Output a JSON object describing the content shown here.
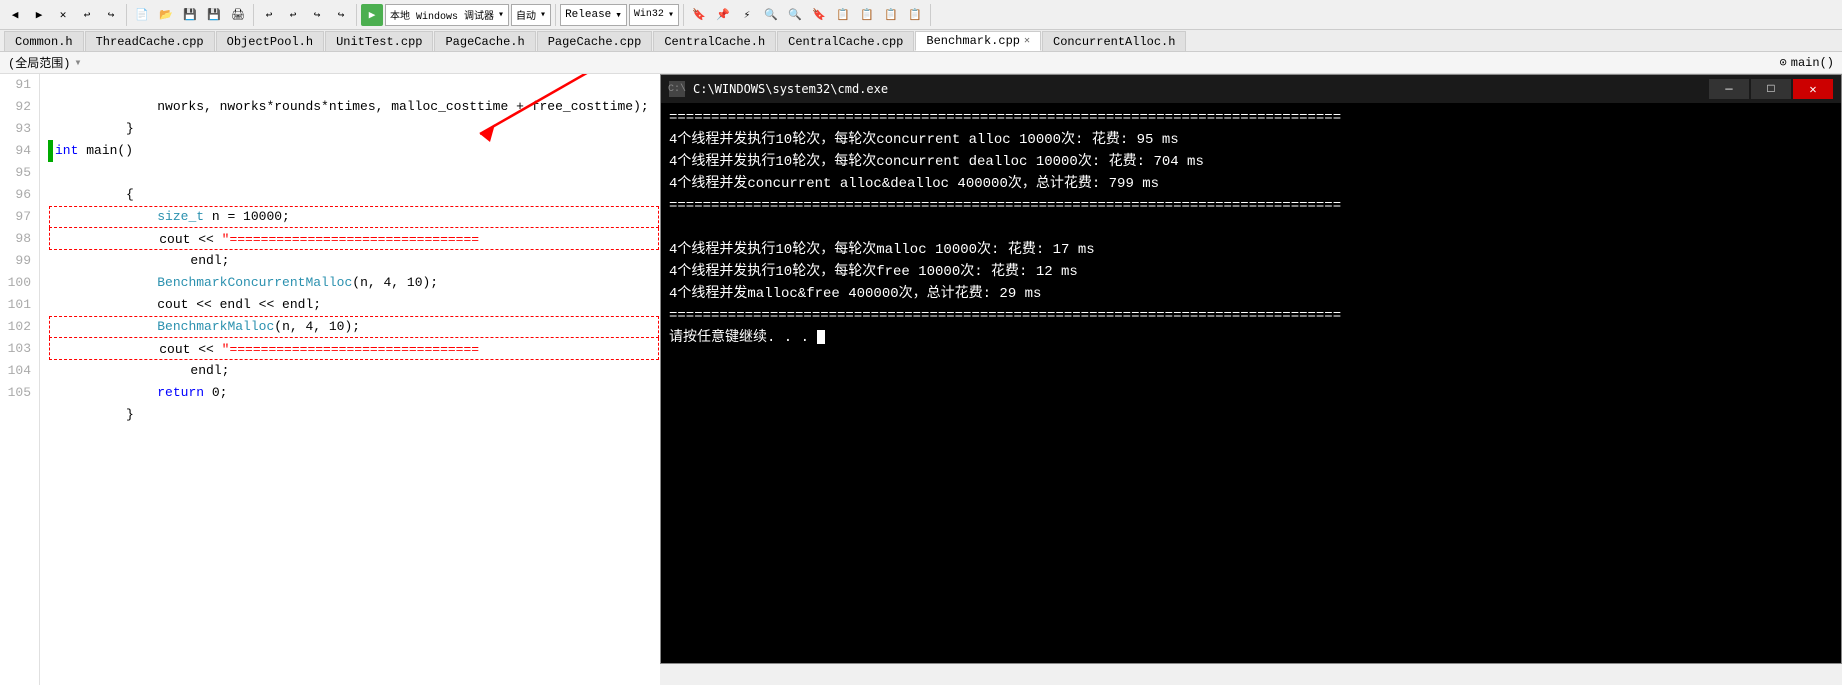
{
  "toolbar": {
    "groups": [
      {
        "buttons": [
          "◀",
          "▶",
          "✕",
          "↩",
          "↪"
        ]
      },
      {
        "buttons": [
          "💾",
          "📋",
          "📂",
          "💾",
          "🖨"
        ]
      },
      {
        "buttons": [
          "↩",
          "↪",
          "↩",
          "↪"
        ]
      },
      {
        "buttons": [
          "▶"
        ]
      },
      {
        "dropdown_local": "本地 Windows 调试器",
        "dropdown_auto": "自动"
      },
      {
        "dropdown_release": "Release",
        "dropdown_win32": "Win32"
      },
      {
        "buttons": [
          "🔖",
          "📌",
          "⚡",
          "🔍",
          "🔍",
          "🔍",
          "🔖",
          "📋",
          "📋",
          "📋",
          "📋"
        ]
      }
    ],
    "play_btn": "▶",
    "local_debugger": "本地 Windows 调试器",
    "auto_label": "自动",
    "release_label": "Release",
    "win32_label": "Win32"
  },
  "tabs": [
    {
      "label": "Common.h",
      "active": false
    },
    {
      "label": "ThreadCache.cpp",
      "active": false
    },
    {
      "label": "ObjectPool.h",
      "active": false
    },
    {
      "label": "UnitTest.cpp",
      "active": false
    },
    {
      "label": "PageCache.h",
      "active": false
    },
    {
      "label": "PageCache.cpp",
      "active": false
    },
    {
      "label": "CentralCache.h",
      "active": false
    },
    {
      "label": "CentralCache.cpp",
      "active": false
    },
    {
      "label": "Benchmark.cpp",
      "active": true,
      "closeable": true
    },
    {
      "label": "ConcurrentAlloc.h",
      "active": false
    }
  ],
  "breadcrumb": {
    "scope": "(全局范围)",
    "function": "main()"
  },
  "code_lines": [
    {
      "num": 91,
      "indent": "    ",
      "content": "nworks, nworks*rounds*ntimes, malloc_costtime + free_costtime);",
      "indicator": false
    },
    {
      "num": 92,
      "indent": "",
      "content": "}",
      "indicator": false
    },
    {
      "num": 93,
      "indent": "",
      "content": "",
      "indicator": false
    },
    {
      "num": 94,
      "indent": "",
      "content": "int main()",
      "indicator": true,
      "has_indicator": true
    },
    {
      "num": 95,
      "indent": "",
      "content": "{",
      "indicator": false
    },
    {
      "num": 96,
      "indent": "    ",
      "content": "size_t n = 10000;",
      "indicator": false
    },
    {
      "num": 97,
      "indent": "    ",
      "content": "cout << \"==============================",
      "indicator": false,
      "dashed": true
    },
    {
      "num": 98,
      "indent": "        ",
      "content": "endl;",
      "indicator": false,
      "dashed": true
    },
    {
      "num": 99,
      "indent": "    ",
      "content": "BenchmarkConcurrentMalloc(n, 4, 10);",
      "indicator": false
    },
    {
      "num": 100,
      "indent": "    ",
      "content": "cout << endl << endl;",
      "indicator": false
    },
    {
      "num": 101,
      "indent": "    ",
      "content": "BenchmarkMalloc(n, 4, 10);",
      "indicator": false
    },
    {
      "num": 102,
      "indent": "    ",
      "content": "cout << \"==============================",
      "indicator": false,
      "dashed": true
    },
    {
      "num": 103,
      "indent": "        ",
      "content": "endl;",
      "indicator": false,
      "dashed": true
    },
    {
      "num": 104,
      "indent": "    ",
      "content": "return 0;",
      "indicator": false
    },
    {
      "num": 105,
      "indent": "",
      "content": "}",
      "indicator": false
    }
  ],
  "cmd": {
    "title": "C:\\WINDOWS\\system32\\cmd.exe",
    "lines": [
      "================================================================================",
      "4个线程并发执行10轮次，每轮次concurrent alloc 10000次: 花费: 95 ms",
      "4个线程并发执行10轮次，每轮次concurrent dealloc 10000次: 花费: 704 ms",
      "4个线程并发concurrent alloc&dealloc 400000次，总计花费: 799 ms",
      "================================================================================",
      "",
      "4个线程并发执行10轮次，每轮次malloc 10000次: 花费: 17 ms",
      "4个线程并发执行10轮次，每轮次free 10000次: 花费: 12 ms",
      "4个线程并发malloc&free 400000次，总计花费: 29 ms",
      "================================================================================",
      "请按任意键继续. . ."
    ]
  }
}
